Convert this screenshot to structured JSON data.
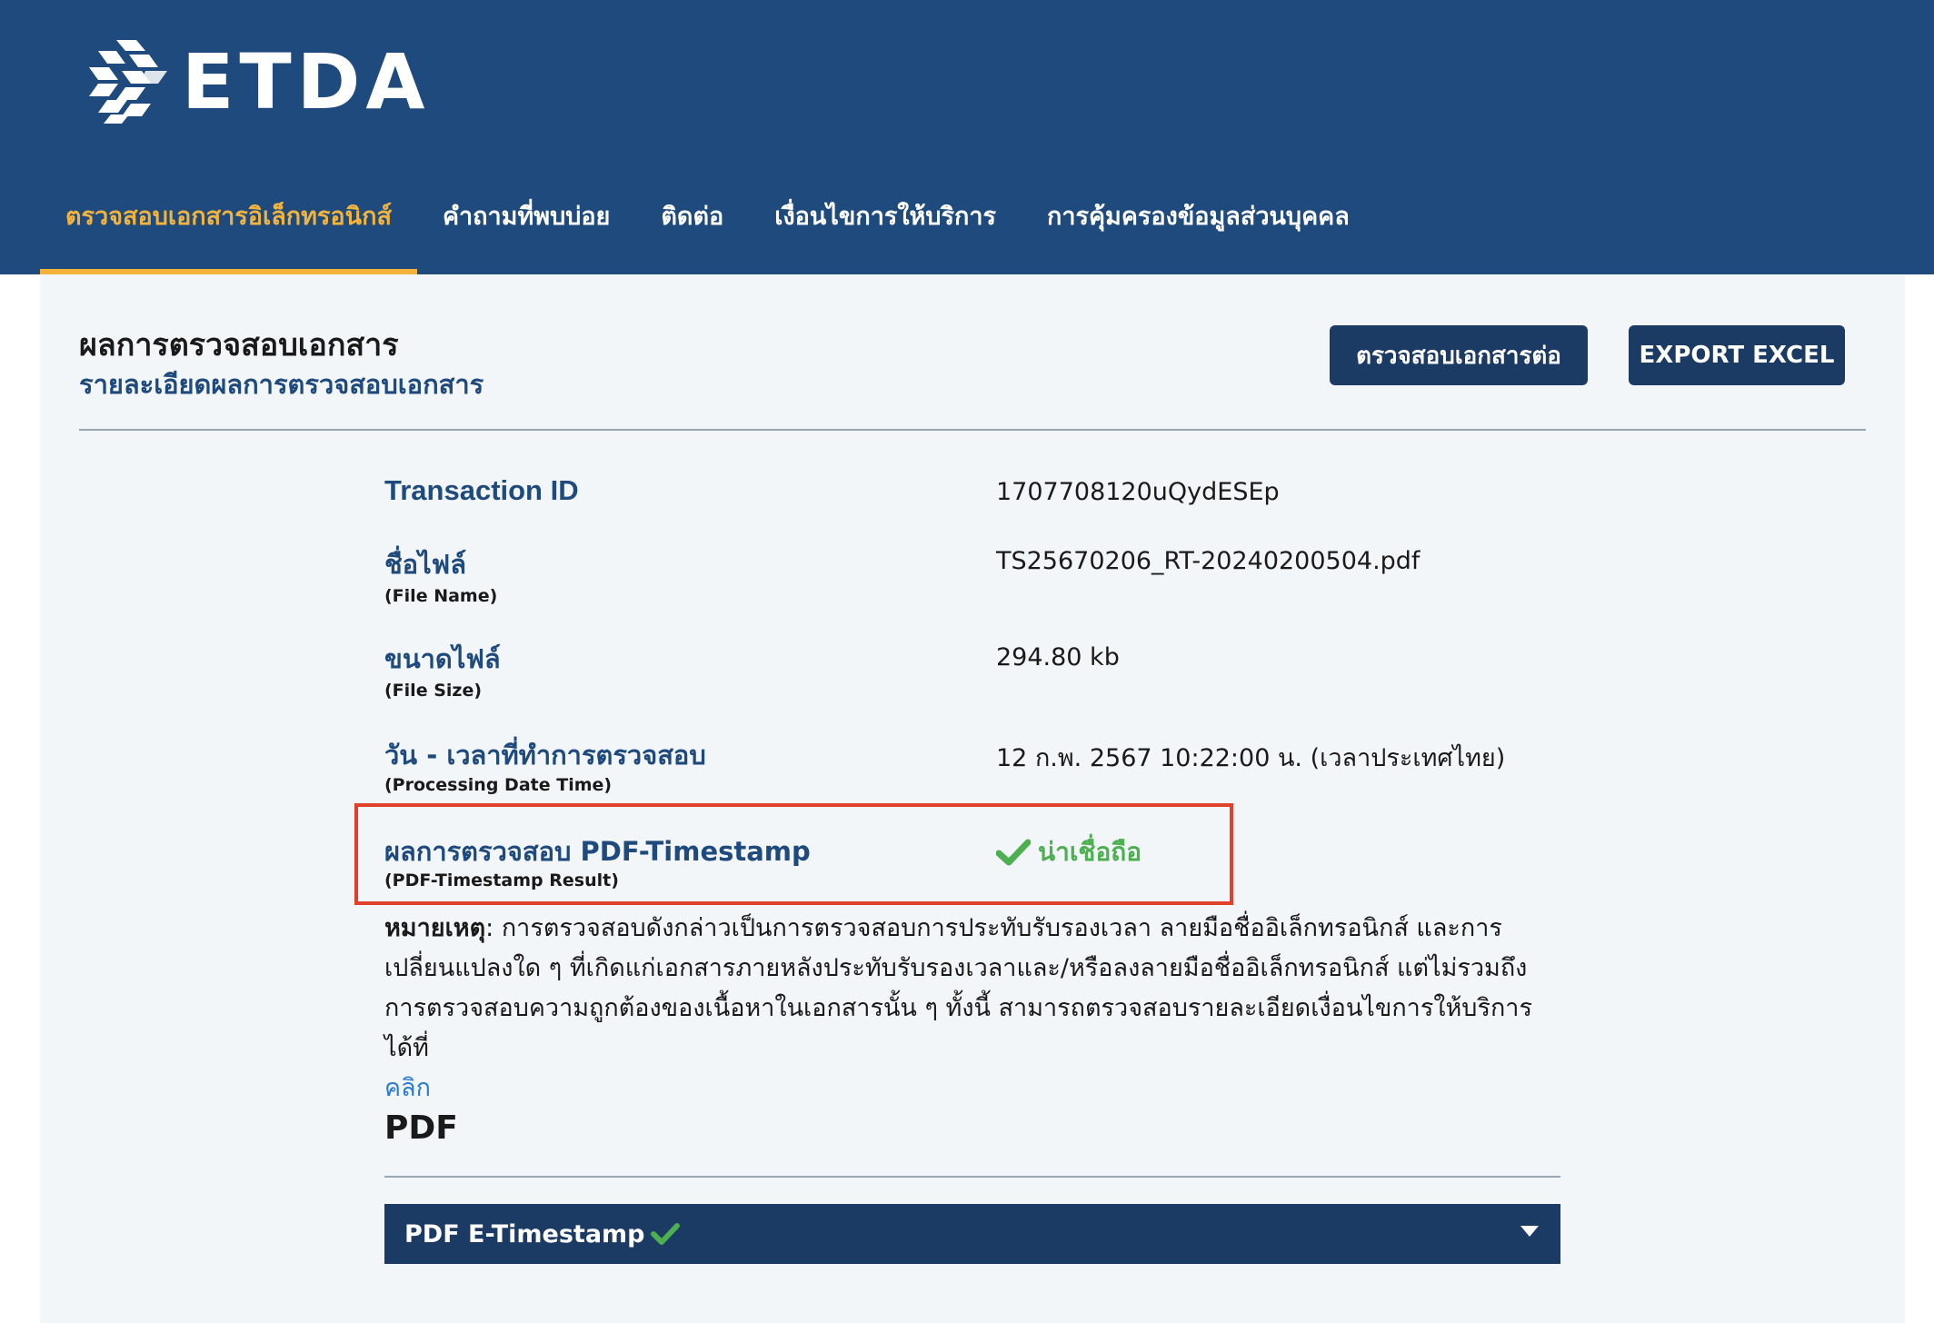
{
  "header": {
    "logo_text": "ETDA",
    "background": "#1f4a7e",
    "nav": [
      {
        "label": "ตรวจสอบเอกสารอิเล็กทรอนิกส์",
        "active": true
      },
      {
        "label": "คำถามที่พบบ่อย",
        "active": false
      },
      {
        "label": "ติดต่อ",
        "active": false
      },
      {
        "label": "เงื่อนไขการให้บริการ",
        "active": false
      },
      {
        "label": "การคุ้มครองข้อมูลส่วนบุคคล",
        "active": false
      }
    ],
    "active_color": "#f2b33d"
  },
  "page": {
    "title": "ผลการตรวจสอบเอกสาร",
    "subtitle": "รายละเอียดผลการตรวจสอบเอกสาร",
    "verify_button": "ตรวจสอบเอกสารต่อ",
    "export_button": "EXPORT EXCEL"
  },
  "details": {
    "transaction_id_label": "Transaction ID",
    "transaction_id_value": "1707708120uQydESEp",
    "file_name_label": "ชื่อไฟล์",
    "file_name_sub": "(File Name)",
    "file_name_value": "TS25670206_RT-20240200504.pdf",
    "file_size_label": "ขนาดไฟล์",
    "file_size_sub": "(File Size)",
    "file_size_value": "294.80 kb",
    "processing_label": "วัน - เวลาที่ทำการตรวจสอบ",
    "processing_sub": "(Processing Date Time)",
    "processing_value": "12 ก.พ. 2567 10:22:00 น. (เวลาประเทศไทย)",
    "result_label": "ผลการตรวจสอบ PDF-Timestamp",
    "result_sub": "(PDF-Timestamp Result)",
    "result_value": "น่าเชื่อถือ",
    "result_icon": "check-icon",
    "result_color": "#4caf50"
  },
  "note": {
    "prefix": "หมายเหตุ",
    "text": ": การตรวจสอบดังกล่าวเป็นการตรวจสอบการประทับรับรองเวลา ลายมือชื่ออิเล็กทรอนิกส์ และการเปลี่ยนแปลงใด ๆ ที่เกิดแก่เอกสารภายหลังประทับรับรองเวลาและ/หรือลงลายมือชื่ออิเล็กทรอนิกส์ แต่ไม่รวมถึงการตรวจสอบความถูกต้องของเนื้อหาในเอกสารนั้น ๆ ทั้งนี้ สามารถตรวจสอบรายละเอียดเงื่อนไขการให้บริการได้ที่",
    "link": "คลิก"
  },
  "pdf_section": {
    "heading": "PDF",
    "accordion_label": "PDF E-Timestamp",
    "accordion_icon": "check-icon",
    "chevron_icon": "caret-down-icon"
  }
}
